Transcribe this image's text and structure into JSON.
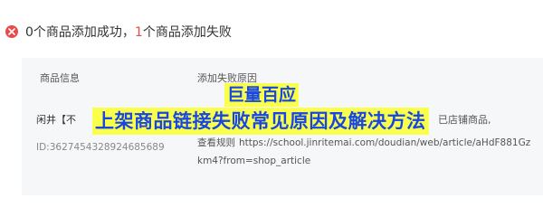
{
  "result": {
    "success_count": "0",
    "success_text": "个商品添加成功，",
    "fail_count": "1",
    "fail_text": "个商品添加失败"
  },
  "table": {
    "columns": [
      "商品信息",
      "添加失败原因"
    ],
    "rows": [
      {
        "product_name": "闲井【不",
        "product_id": "ID:3627454328924685689",
        "reason_tail": "已店铺商品,",
        "rule_label": "查看规则",
        "rule_url": "https://school.jinritemai.com/doudian/web/article/aHdF881Gzkm4?from=shop_article"
      }
    ]
  },
  "overlay": {
    "brand": "巨量百应",
    "title": "上架商品链接失败常见原因及解决方法"
  },
  "colors": {
    "error_red": "#e84b4b",
    "banner_bg": "#f9ff4a",
    "banner_text": "#1846e6",
    "panel_bg": "#f6f7f9"
  }
}
